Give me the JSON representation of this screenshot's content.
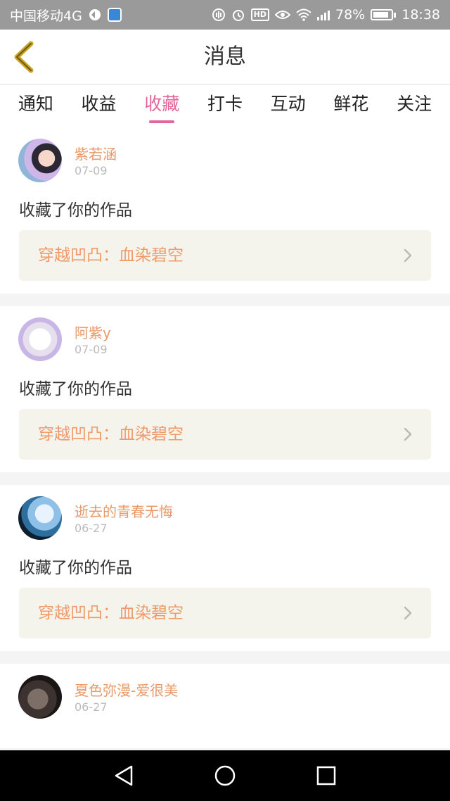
{
  "status_bar": {
    "carrier": "中国移动4G",
    "battery": "78%",
    "time": "18:38",
    "network": "4G"
  },
  "header": {
    "title": "消息"
  },
  "tabs": [
    {
      "label": "通知"
    },
    {
      "label": "收益"
    },
    {
      "label": "收藏",
      "active": true
    },
    {
      "label": "打卡"
    },
    {
      "label": "互动"
    },
    {
      "label": "鲜花"
    },
    {
      "label": "关注"
    }
  ],
  "messages": [
    {
      "user": "紫若涵",
      "date": "07-09",
      "text": "收藏了你的作品",
      "work": "穿越凹凸：血染碧空"
    },
    {
      "user": "阿紫y",
      "date": "07-09",
      "text": "收藏了你的作品",
      "work": "穿越凹凸：血染碧空"
    },
    {
      "user": "逝去的青春无悔",
      "date": "06-27",
      "text": "收藏了你的作品",
      "work": "穿越凹凸：血染碧空"
    },
    {
      "user": "夏色弥漫-爱很美",
      "date": "06-27"
    }
  ],
  "colors": {
    "accent": "#e0669b",
    "username": "#e89a6a",
    "work_title": "#ee9a6a",
    "work_bg": "#f5f4ec"
  },
  "icons": {
    "back": "back-chevron-icon",
    "card_arrow": "chevron-right-icon",
    "nav": [
      "nav-back-icon",
      "nav-home-icon",
      "nav-recents-icon"
    ]
  }
}
